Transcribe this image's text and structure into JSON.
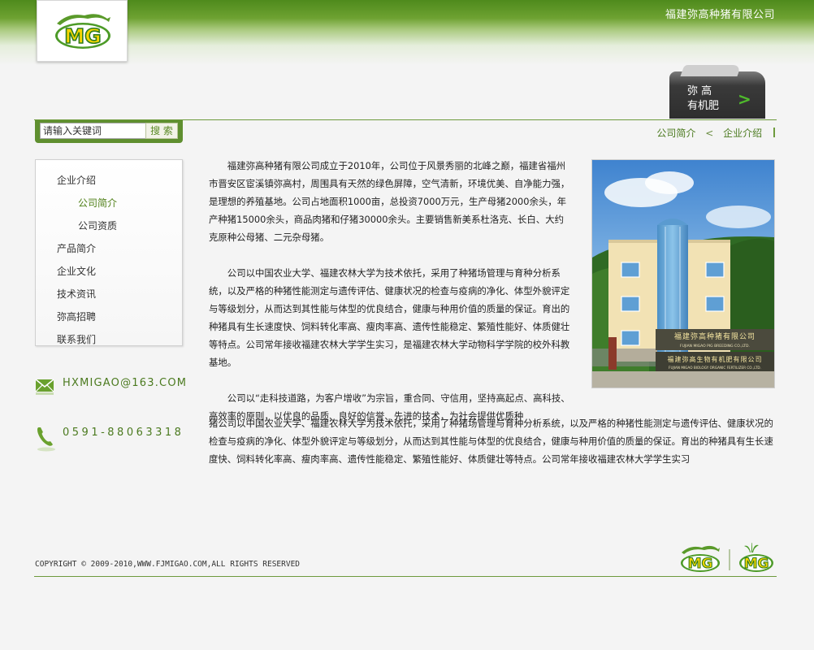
{
  "header": {
    "company_name": "福建弥高种猪有限公司",
    "logo_text": "MG"
  },
  "slogan": {
    "line1": "弥  高",
    "line2": "有机肥",
    "arrow": ">"
  },
  "search": {
    "placeholder": "请输入关键词",
    "value": "请输入关键词",
    "button_label": "搜 索"
  },
  "breadcrumb": {
    "current": "公司简介",
    "separator": "<",
    "parent": "企业介绍"
  },
  "sidebar": {
    "items": [
      {
        "label": "企业介绍",
        "level": 1
      },
      {
        "label": "公司简介",
        "level": 2,
        "active": true
      },
      {
        "label": "公司资质",
        "level": 2
      },
      {
        "label": "产品简介",
        "level": 1
      },
      {
        "label": "企业文化",
        "level": 1
      },
      {
        "label": "技术资讯",
        "level": 1
      },
      {
        "label": "弥高招聘",
        "level": 1
      },
      {
        "label": "联系我们",
        "level": 1
      }
    ]
  },
  "contact": {
    "email": "HXMIGAO@163.COM",
    "phone": "0591-88063318"
  },
  "content": {
    "p1": "福建弥高种猪有限公司成立于2010年，公司位于风景秀丽的北峰之巅，福建省福州市晋安区宦溪镇弥高村，周围具有天然的绿色屏障，空气清新，环境优美、自净能力强，是理想的养殖基地。公司占地面积1000亩，总投资7000万元，生产母猪2000余头，年产种猪15000余头，商品肉猪和仔猪30000余头。主要销售新美系杜洛克、长白、大约克原种公母猪、二元杂母猪。",
    "p2": "公司以中国农业大学、福建农林大学为技术依托，采用了种猪场管理与育种分析系统，以及严格的种猪性能测定与遗传评估、健康状况的检查与疫病的净化、体型外貌评定与等级划分，从而达到其性能与体型的优良结合，健康与种用价值的质量的保证。育出的种猪具有生长速度快、饲料转化率高、瘦肉率高、遗传性能稳定、繁殖性能好、体质健壮等特点。公司常年接收福建农林大学学生实习，是福建农林大学动物科学学院的校外科教基地。",
    "p3_narrow": "公司以“走科技道路，为客户增收”为宗旨，重合同、守信用，坚持高起点、高科技、高效率的原则，以优良的品质、良好的信誉、先进的技术，为社会提供优质种",
    "p3_wide": "猪公司以中国农业大学、福建农林大学为技术依托，采用了种猪场管理与育种分析系统，以及严格的种猪性能测定与遗传评估、健康状况的检查与疫病的净化、体型外貌评定与等级划分，从而达到其性能与体型的优良结合，健康与种用价值的质量的保证。育出的种猪具有生长速度快、饲料转化率高、瘦肉率高、遗传性能稳定、繁殖性能好、体质健壮等特点。公司常年接收福建农林大学学生实习"
  },
  "photo": {
    "sign_line1": "福建弥高种猪有限公司",
    "sign_line1_en": "FUJIAN MIGAO PIG BREEDING CO.,LTD.",
    "sign_line2": "福建弥高生物有机肥有限公司",
    "sign_line2_en": "FUJIAN MIGAO BIOLOGY ORGANIC FERTILIZER CO.,LTD."
  },
  "footer": {
    "copyright": "COPYRIGHT © 2009-2010,WWW.FJMIGAO.COM,ALL RIGHTS RESERVED",
    "logo1": "MG",
    "logo2": "MG"
  },
  "colors": {
    "brand_green": "#5f8f2f",
    "text_green": "#4b7a1f",
    "logo_yellow": "#f5d500"
  }
}
